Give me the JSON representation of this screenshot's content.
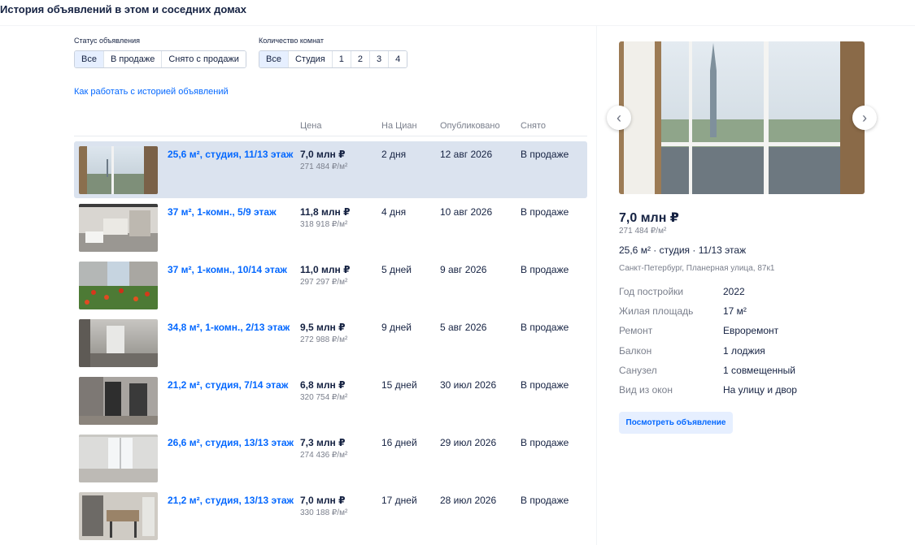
{
  "page": {
    "title": "История объявлений в этом и соседних домах"
  },
  "filters": {
    "status": {
      "label": "Статус объявления",
      "options": [
        "Все",
        "В продаже",
        "Снято с продажи"
      ],
      "selected": "Все"
    },
    "rooms": {
      "label": "Количество комнат",
      "options": [
        "Все",
        "Студия",
        "1",
        "2",
        "3",
        "4"
      ],
      "selected": "Все"
    }
  },
  "help_link": "Как работать с историей объявлений",
  "table": {
    "headers": {
      "price": "Цена",
      "on_cian": "На Циан",
      "published": "Опубликовано",
      "removed": "Снято"
    },
    "rows": [
      {
        "title": "25,6 м², студия, 11/13 этаж",
        "price": "7,0 млн ₽",
        "ppm": "271 484 ₽/м²",
        "on_cian": "2 дня",
        "published": "12 авг 2026",
        "status": "В продаже",
        "photo": "window-view"
      },
      {
        "title": "37 м², 1-комн., 5/9 этаж",
        "price": "11,8 млн ₽",
        "ppm": "318 918 ₽/м²",
        "on_cian": "4 дня",
        "published": "10 авг 2026",
        "status": "В продаже",
        "photo": "interior"
      },
      {
        "title": "37 м², 1-комн., 10/14 этаж",
        "price": "11,0 млн ₽",
        "ppm": "297 297 ₽/м²",
        "on_cian": "5 дней",
        "published": "9 авг 2026",
        "status": "В продаже",
        "photo": "garden"
      },
      {
        "title": "34,8 м², 1-комн., 2/13 этаж",
        "price": "9,5 млн ₽",
        "ppm": "272 988 ₽/м²",
        "on_cian": "9 дней",
        "published": "5 авг 2026",
        "status": "В продаже",
        "photo": "empty-room"
      },
      {
        "title": "21,2 м², студия, 7/14 этаж",
        "price": "6,8 млн ₽",
        "ppm": "320 754 ₽/м²",
        "on_cian": "15 дней",
        "published": "30 июл 2026",
        "status": "В продаже",
        "photo": "door"
      },
      {
        "title": "26,6 м², студия, 13/13 этаж",
        "price": "7,3 млн ₽",
        "ppm": "274 436 ₽/м²",
        "on_cian": "16 дней",
        "published": "29 июл 2026",
        "status": "В продаже",
        "photo": "bright-room"
      },
      {
        "title": "21,2 м², студия, 13/13 этаж",
        "price": "7,0 млн ₽",
        "ppm": "330 188 ₽/м²",
        "on_cian": "17 дней",
        "published": "28 июл 2026",
        "status": "В продаже",
        "photo": "kitchen"
      }
    ]
  },
  "detail": {
    "price": "7,0 млн ₽",
    "ppm": "271 484 ₽/м²",
    "summary": "25,6 м² · студия · 11/13 этаж",
    "address": "Санкт-Петербург, Планерная улица, 87к1",
    "specs": [
      {
        "key": "Год постройки",
        "value": "2022"
      },
      {
        "key": "Жилая площадь",
        "value": "17 м²"
      },
      {
        "key": "Ремонт",
        "value": "Евроремонт"
      },
      {
        "key": "Балкон",
        "value": "1 лоджия"
      },
      {
        "key": "Санузел",
        "value": "1 совмещенный"
      },
      {
        "key": "Вид из окон",
        "value": "На улицу и двор"
      }
    ],
    "view_button": "Посмотреть объявление",
    "prev_icon": "chevron-left-icon",
    "next_icon": "chevron-right-icon"
  }
}
